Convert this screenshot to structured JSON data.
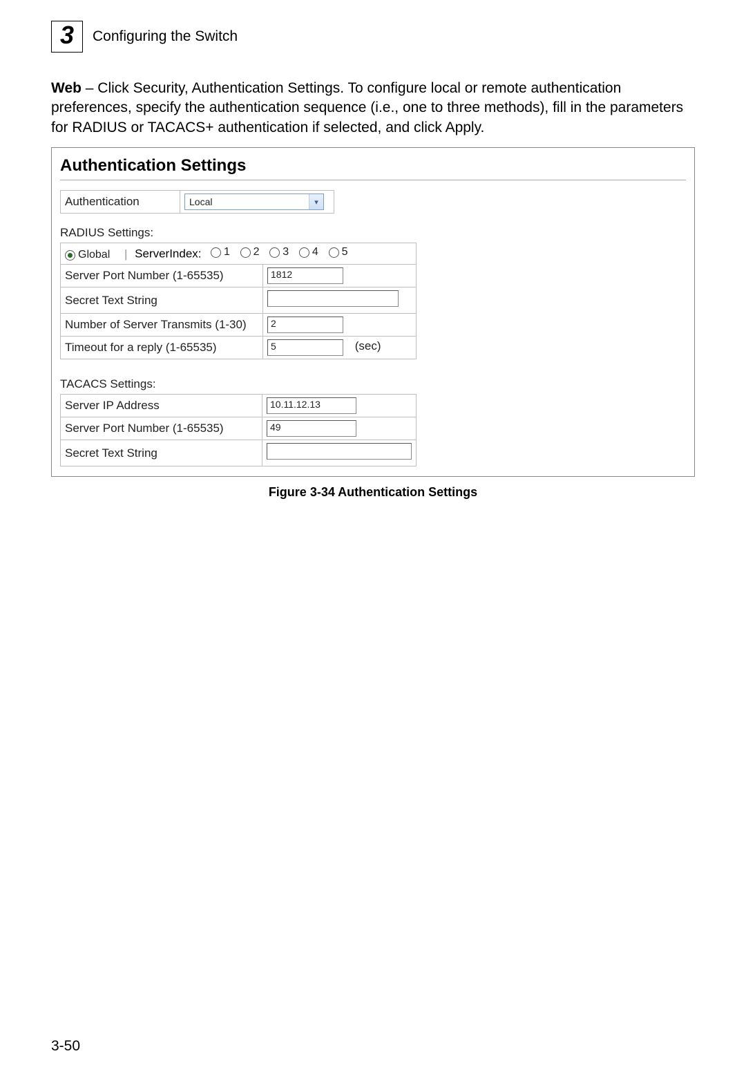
{
  "header": {
    "chapter_number": "3",
    "chapter_title": "Configuring the Switch"
  },
  "intro": {
    "lead": "Web",
    "text": " – Click Security, Authentication Settings. To configure local or remote authentication preferences, specify the authentication sequence (i.e., one to three methods), fill in the parameters for RADIUS or TACACS+ authentication if selected, and click Apply."
  },
  "panel": {
    "title": "Authentication Settings",
    "auth_row": {
      "label": "Authentication",
      "selected": "Local"
    },
    "radius": {
      "heading": "RADIUS Settings:",
      "global_label": "Global",
      "server_index_label": "ServerIndex:",
      "indices": [
        "1",
        "2",
        "3",
        "4",
        "5"
      ],
      "rows": {
        "port_label": "Server Port Number (1-65535)",
        "port_value": "1812",
        "secret_label": "Secret Text String",
        "secret_value": "",
        "transmits_label": "Number of Server Transmits (1-30)",
        "transmits_value": "2",
        "timeout_label": "Timeout for a reply (1-65535)",
        "timeout_value": "5",
        "timeout_suffix": "(sec)"
      }
    },
    "tacacs": {
      "heading": "TACACS Settings:",
      "rows": {
        "ip_label": "Server IP Address",
        "ip_value": "10.11.12.13",
        "port_label": "Server Port Number (1-65535)",
        "port_value": "49",
        "secret_label": "Secret Text String",
        "secret_value": ""
      }
    }
  },
  "caption": "Figure 3-34  Authentication Settings",
  "page_number": "3-50"
}
